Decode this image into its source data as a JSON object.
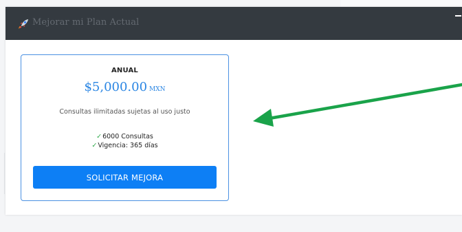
{
  "modal": {
    "title": "Mejorar mi Plan Actual",
    "header_icon": "rocket-icon",
    "minimize_icon": "minimize-icon"
  },
  "plan": {
    "name": "ANUAL",
    "price": "$5,000.00",
    "currency": "MXN",
    "description": "Consultas ilimitadas sujetas al uso justo",
    "features": [
      {
        "icon": "check-icon",
        "text": "6000 Consultas"
      },
      {
        "icon": "check-icon",
        "text": "Vigencia: 365 días"
      }
    ],
    "button_label": "SOLICITAR MEJORA"
  },
  "colors": {
    "header_bg": "#343a40",
    "accent": "#0d7ff5",
    "price": "#2b86e3",
    "check": "#28a745",
    "annotation_arrow": "#1aa34a"
  }
}
